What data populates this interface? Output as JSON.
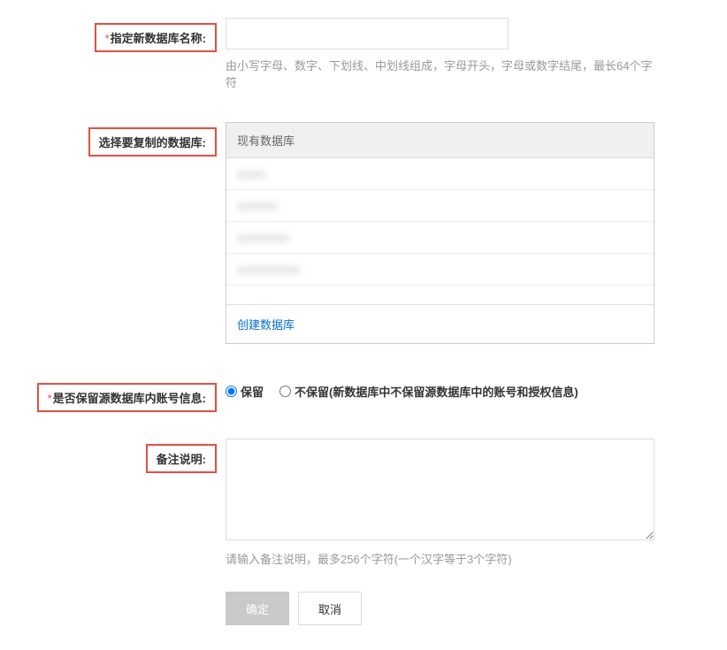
{
  "form": {
    "newDbName": {
      "label": "指定新数据库名称:",
      "value": "",
      "hint": "由小写字母、数字、下划线、中划线组成，字母开头，字母或数字结尾，最长64个字符"
    },
    "sourceDb": {
      "label": "选择要复制的数据库:",
      "header": "现有数据库",
      "items": [
        "xxxxx",
        "xxxxxxx",
        "xxxxxxxxx",
        "xxxxxxxxxxx"
      ],
      "createLink": "创建数据库"
    },
    "keepAccount": {
      "label": "是否保留源数据库内账号信息:",
      "option1": "保留",
      "option2": "不保留(新数据库中不保留源数据库中的账号和授权信息)"
    },
    "remark": {
      "label": "备注说明:",
      "value": "",
      "hint": "请输入备注说明，最多256个字符(一个汉字等于3个字符)"
    }
  },
  "buttons": {
    "confirm": "确定",
    "cancel": "取消"
  }
}
